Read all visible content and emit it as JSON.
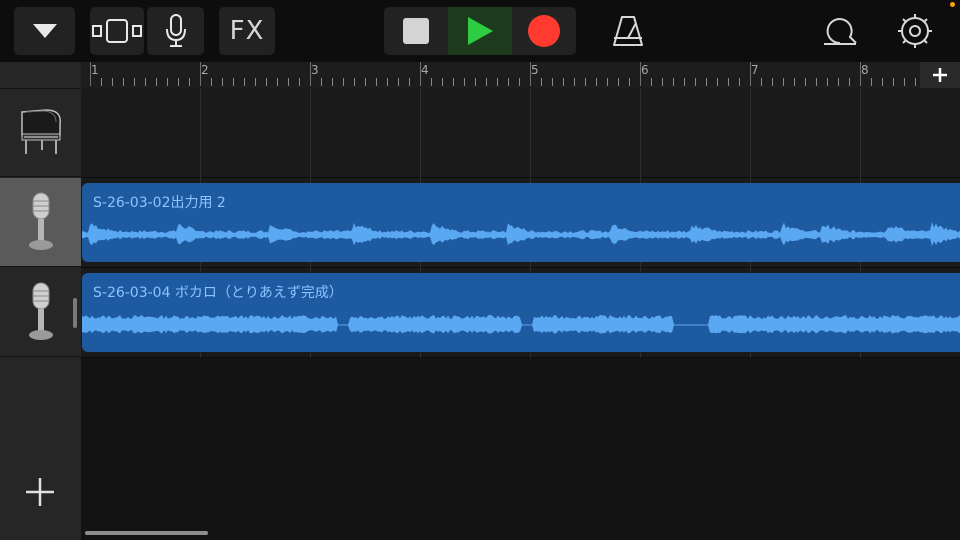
{
  "toolbar": {
    "fx_label": "FX"
  },
  "ruler": {
    "bars": [
      "1",
      "2",
      "3",
      "4",
      "5",
      "6",
      "7",
      "8"
    ]
  },
  "tracks": [
    {
      "instrument": "grand-piano",
      "region": null
    },
    {
      "instrument": "microphone",
      "region": {
        "label": "S-26-03-02出力用 2"
      }
    },
    {
      "instrument": "microphone",
      "region": {
        "label": "S-26-03-04 ボカロ（とりあえず完成）"
      }
    }
  ],
  "colors": {
    "region": "#1d5aa0",
    "waveform": "#5aa7f2",
    "region_label": "#8fc2ff",
    "play": "#2ecc40",
    "record": "#ff3b30",
    "indicator_dot": "#ff9f0a"
  }
}
